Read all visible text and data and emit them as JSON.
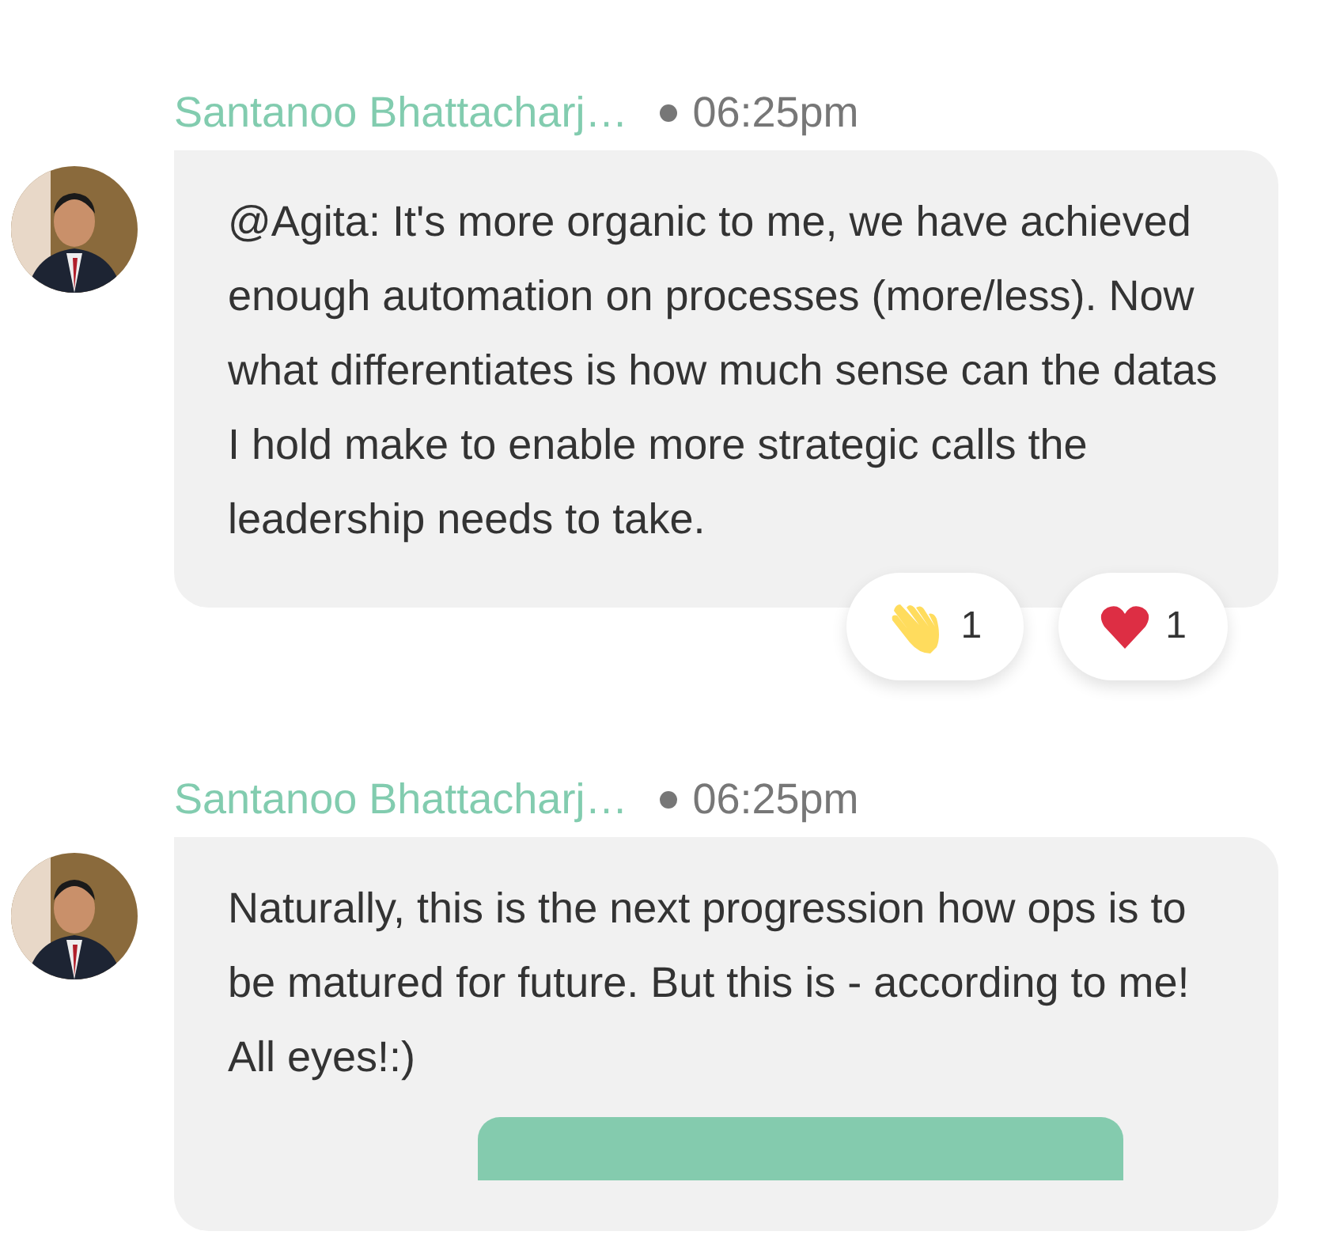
{
  "messages": [
    {
      "author": "Santanoo Bhattacharj…",
      "time": "06:25pm",
      "text": "@Agita: It's more organic to me, we have achieved enough automation on processes (more/less). Now what differentiates is how much sense can the datas I hold make to enable more strategic calls the leadership needs to take.",
      "reactions": [
        {
          "kind": "wave",
          "count": "1"
        },
        {
          "kind": "heart",
          "count": "1"
        }
      ],
      "attachment_bar": false
    },
    {
      "author": "Santanoo Bhattacharj…",
      "time": "06:25pm",
      "text": "Naturally, this is the next progression how ops is to be matured for future. But this is - according to me! All eyes!:)",
      "attachment_bar": true
    }
  ]
}
